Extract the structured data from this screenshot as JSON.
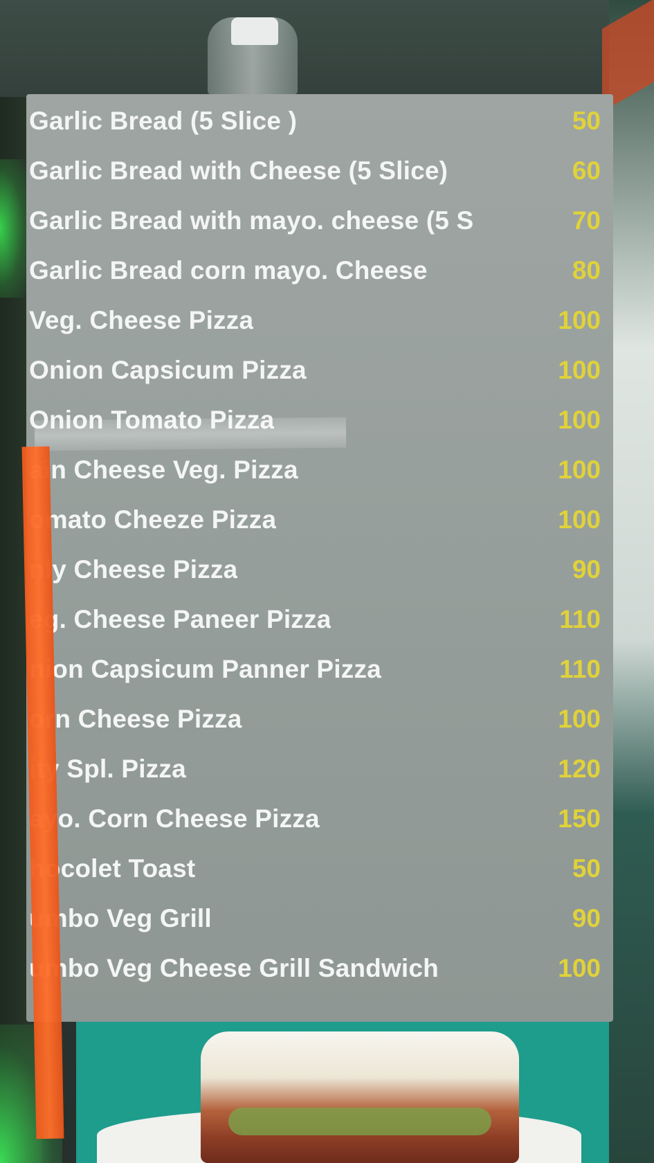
{
  "menu": {
    "items": [
      {
        "name": "Garlic Bread (5 Slice )",
        "price": "50"
      },
      {
        "name": "Garlic Bread with Cheese (5 Slice)",
        "price": "60"
      },
      {
        "name": "Garlic Bread with mayo. cheese (5 S",
        "price": "70"
      },
      {
        "name": "Garlic Bread corn mayo. Cheese",
        "price": "80"
      },
      {
        "name": "Veg. Cheese Pizza",
        "price": "100"
      },
      {
        "name": "Onion Capsicum Pizza",
        "price": "100"
      },
      {
        "name": "Onion Tomato Pizza",
        "price": "100"
      },
      {
        "name": "ain Cheese Veg. Pizza",
        "price": "100"
      },
      {
        "name": "omato Cheeze Pizza",
        "price": "100"
      },
      {
        "name": "nly Cheese Pizza",
        "price": "90"
      },
      {
        "name": "eg. Cheese Paneer Pizza",
        "price": "110"
      },
      {
        "name": "nion Capsicum Panner Pizza",
        "price": "110"
      },
      {
        "name": "orn Cheese Pizza",
        "price": "100"
      },
      {
        "name": "ity Spl. Pizza",
        "price": "120"
      },
      {
        "name": "ayo. Corn Cheese Pizza",
        "price": "150"
      },
      {
        "name": "hocolet Toast",
        "price": "50"
      },
      {
        "name": "umbo Veg Grill",
        "price": "90"
      },
      {
        "name": "umbo Veg  Cheese Grill Sandwich",
        "price": "100"
      }
    ]
  },
  "colors": {
    "board": "#9aa19e",
    "item_text": "#f4f6f5",
    "price_text": "#e0d23a",
    "tape": "#f05a1e",
    "poster": "#1e9c8c"
  }
}
